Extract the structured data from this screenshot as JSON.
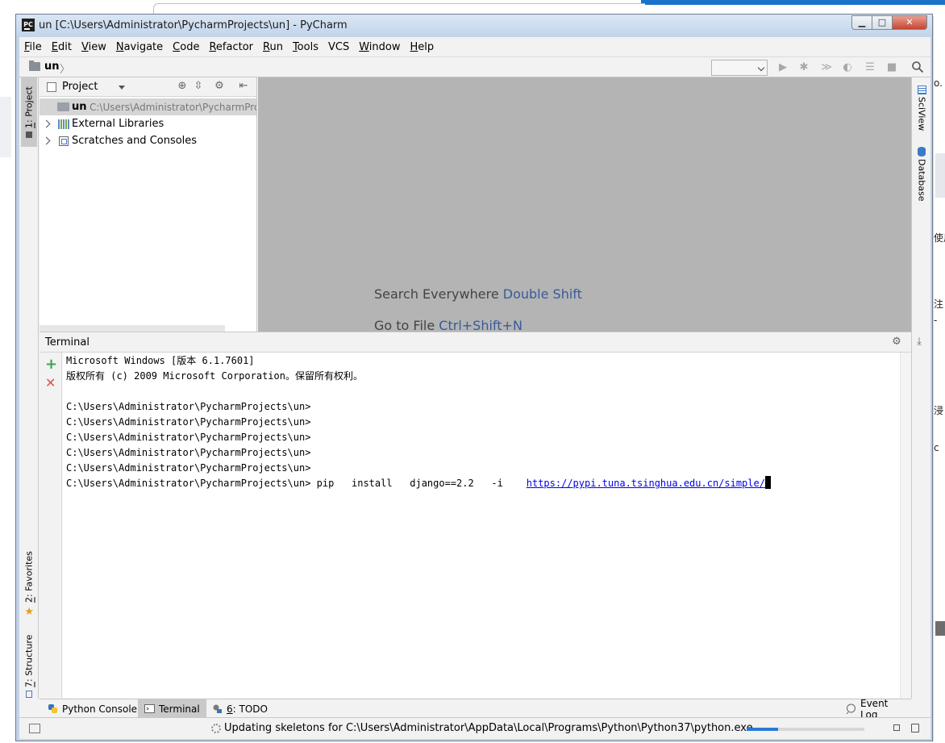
{
  "window": {
    "title": "un [C:\\Users\\Administrator\\PycharmProjects\\un] - PyCharm",
    "app_icon_text": "PC",
    "minimize_symbol": "▁",
    "maximize_symbol": "□",
    "close_symbol": "✕"
  },
  "menu": [
    {
      "mnemonic": "F",
      "rest": "ile"
    },
    {
      "mnemonic": "E",
      "rest": "dit"
    },
    {
      "mnemonic": "V",
      "rest": "iew"
    },
    {
      "mnemonic": "N",
      "rest": "avigate"
    },
    {
      "mnemonic": "C",
      "rest": "ode"
    },
    {
      "mnemonic": "R",
      "rest": "efactor"
    },
    {
      "mnemonic": "R",
      "rest": "un"
    },
    {
      "mnemonic": "T",
      "rest": "ools"
    },
    {
      "mnemonic": "",
      "rest": "VCS"
    },
    {
      "mnemonic": "W",
      "rest": "indow"
    },
    {
      "mnemonic": "H",
      "rest": "elp"
    }
  ],
  "navbar": {
    "breadcrumb": "un",
    "breadcrumb_arrow": "〉",
    "run_config_value": ""
  },
  "left_strip": {
    "project_tab_num": "1",
    "project_tab_label": ": Project",
    "favorites_tab_num": "2",
    "favorites_tab_label": ": Favorites",
    "structure_tab_num": "7",
    "structure_tab_label": ": Structure"
  },
  "right_strip": {
    "sciview_label": "SciView",
    "database_label": "Database"
  },
  "project_panel": {
    "title": "Project",
    "tree": [
      {
        "name": "un",
        "path": "C:\\Users\\Administrator\\PycharmProjects\\un",
        "selected": true
      },
      {
        "name": "External Libraries"
      },
      {
        "name": "Scratches and Consoles"
      }
    ]
  },
  "editor_hints": [
    {
      "text": "Search Everywhere",
      "key": "Double Shift"
    },
    {
      "text": "Go to File",
      "key": "Ctrl+Shift+N"
    }
  ],
  "terminal": {
    "title": "Terminal",
    "lines": [
      "Microsoft Windows [版本 6.1.7601]",
      "版权所有 (c) 2009 Microsoft Corporation。保留所有权利。",
      "",
      "C:\\Users\\Administrator\\PycharmProjects\\un>",
      "C:\\Users\\Administrator\\PycharmProjects\\un>",
      "C:\\Users\\Administrator\\PycharmProjects\\un>",
      "C:\\Users\\Administrator\\PycharmProjects\\un>",
      "C:\\Users\\Administrator\\PycharmProjects\\un>"
    ],
    "command_prompt": "C:\\Users\\Administrator\\PycharmProjects\\un>",
    "command_text": " pip   install   django==2.2   -i    ",
    "command_url": "https://pypi.tuna.tsinghua.edu.cn/simple/"
  },
  "bottom_tabs": {
    "python_console": "Python Console",
    "terminal": "Terminal",
    "todo_num": "6",
    "todo_label": ": TODO",
    "event_log": "Event Log"
  },
  "status": {
    "message": "Updating skeletons for C:\\Users\\Administrator\\AppData\\Local\\Programs\\Python\\Python37\\python.exe...",
    "progress_fraction": 0.27
  },
  "colors": {
    "link": "#0000ee",
    "hint_key": "#375b9b",
    "progress": "#2a7ad5",
    "add_green": "#3aa345",
    "close_red": "#d9534f"
  },
  "background_fragments": [
    "o.",
    "使用",
    "注",
    "-",
    "浸",
    "c"
  ]
}
